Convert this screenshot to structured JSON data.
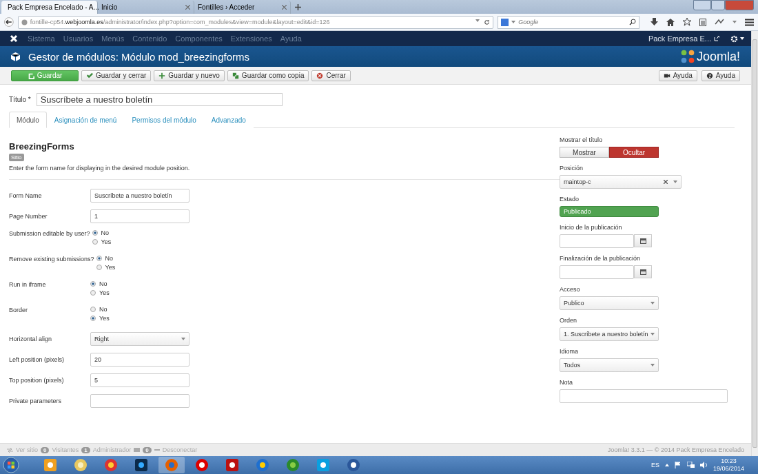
{
  "browser": {
    "tabs": [
      {
        "label": "Pack Empresa Encelado - A...",
        "selected": true
      },
      {
        "label": "Inicio",
        "selected": false
      },
      {
        "label": "Fontilles › Acceder",
        "selected": false
      }
    ],
    "url": "fontille-cp54.**webjoomla.es**/administrator/index.php?option=com_modules&view=module&layout=edit&id=126",
    "search": {
      "placeholder": "Google"
    }
  },
  "admin_nav": {
    "items": [
      "Sistema",
      "Usuarios",
      "Menús",
      "Contenido",
      "Componentes",
      "Extensiones",
      "Ayuda"
    ],
    "site_name": "Pack Empresa E..."
  },
  "header": {
    "title": "Gestor de módulos: Módulo mod_breezingforms",
    "logo_text": "Joomla!"
  },
  "toolbar": {
    "buttons": [
      {
        "label": "Guardar",
        "kind": "primary"
      },
      {
        "label": "Guardar y cerrar",
        "kind": "default"
      },
      {
        "label": "Guardar y nuevo",
        "kind": "default"
      },
      {
        "label": "Guardar como copia",
        "kind": "default"
      },
      {
        "label": "Cerrar",
        "kind": "default"
      }
    ],
    "right_buttons": [
      {
        "label": "Ayuda"
      },
      {
        "label": "Ayuda"
      }
    ]
  },
  "title_field": {
    "label": "Título *",
    "value": "Suscríbete a nuestro boletín"
  },
  "tabs": [
    {
      "label": "Módulo",
      "selected": true
    },
    {
      "label": "Asignación de menú",
      "selected": false
    },
    {
      "label": "Permisos del módulo",
      "selected": false
    },
    {
      "label": "Advanzado",
      "selected": false
    }
  ],
  "module": {
    "heading": "BreezingForms",
    "badge": "Sitio",
    "description": "Enter the form name for displaying in the desired module position."
  },
  "params": [
    {
      "label": "Form Name",
      "kind": "text",
      "value": "Suscríbete a nuestro boletín"
    },
    {
      "label": "Page Number",
      "kind": "text",
      "value": "1"
    },
    {
      "label": "Submission editable by user?",
      "kind": "radio",
      "options": [
        {
          "label": "No",
          "selected": true
        },
        {
          "label": "Yes",
          "selected": false
        }
      ]
    },
    {
      "label": "Remove existing submissions?",
      "kind": "radio",
      "options": [
        {
          "label": "No",
          "selected": true
        },
        {
          "label": "Yes",
          "selected": false
        }
      ]
    },
    {
      "label": "Run in iframe",
      "kind": "radio",
      "options": [
        {
          "label": "No",
          "selected": true
        },
        {
          "label": "Yes",
          "selected": false
        }
      ]
    },
    {
      "label": "Border",
      "kind": "radio",
      "options": [
        {
          "label": "No",
          "selected": false
        },
        {
          "label": "Yes",
          "selected": true
        }
      ]
    },
    {
      "label": "Horizontal align",
      "kind": "select",
      "value": "Right"
    },
    {
      "label": "Left position (pixels)",
      "kind": "text",
      "value": "20"
    },
    {
      "label": "Top position (pixels)",
      "kind": "text",
      "value": "5"
    },
    {
      "label": "Private parameters",
      "kind": "text"
    }
  ],
  "side": [
    {
      "label": "Mostrar el título",
      "kind": "toggle",
      "options": [
        {
          "label": "Mostrar",
          "selected": false
        },
        {
          "label": "Ocultar",
          "selected": true
        }
      ]
    },
    {
      "label": "Posición",
      "kind": "chosen",
      "value": "maintop-c"
    },
    {
      "label": "Estado",
      "kind": "status",
      "value": "Publicado"
    },
    {
      "label": "Inicio de la publicación",
      "kind": "date"
    },
    {
      "label": "Finalización de la publicación",
      "kind": "date"
    },
    {
      "label": "Acceso",
      "kind": "select",
      "value": "Publico"
    },
    {
      "label": "Orden",
      "kind": "select",
      "value": "1. Suscríbete a nuestro boletín"
    },
    {
      "label": "Idioma",
      "kind": "select",
      "value": "Todos"
    },
    {
      "label": "Nota",
      "kind": "note"
    }
  ],
  "status_bar": {
    "view_site": "Ver sitio",
    "counters": [
      {
        "count": "0",
        "label": "Visitantes"
      },
      {
        "count": "1",
        "label": "Administrador"
      },
      {
        "count": "0"
      }
    ],
    "logout": "Desconectar",
    "footer": "Joomla! 3.3.1 — © 2014 Pack Empresa Encelado"
  },
  "taskbar": {
    "language": "ES",
    "time": "10:23",
    "date": "19/06/2014"
  }
}
